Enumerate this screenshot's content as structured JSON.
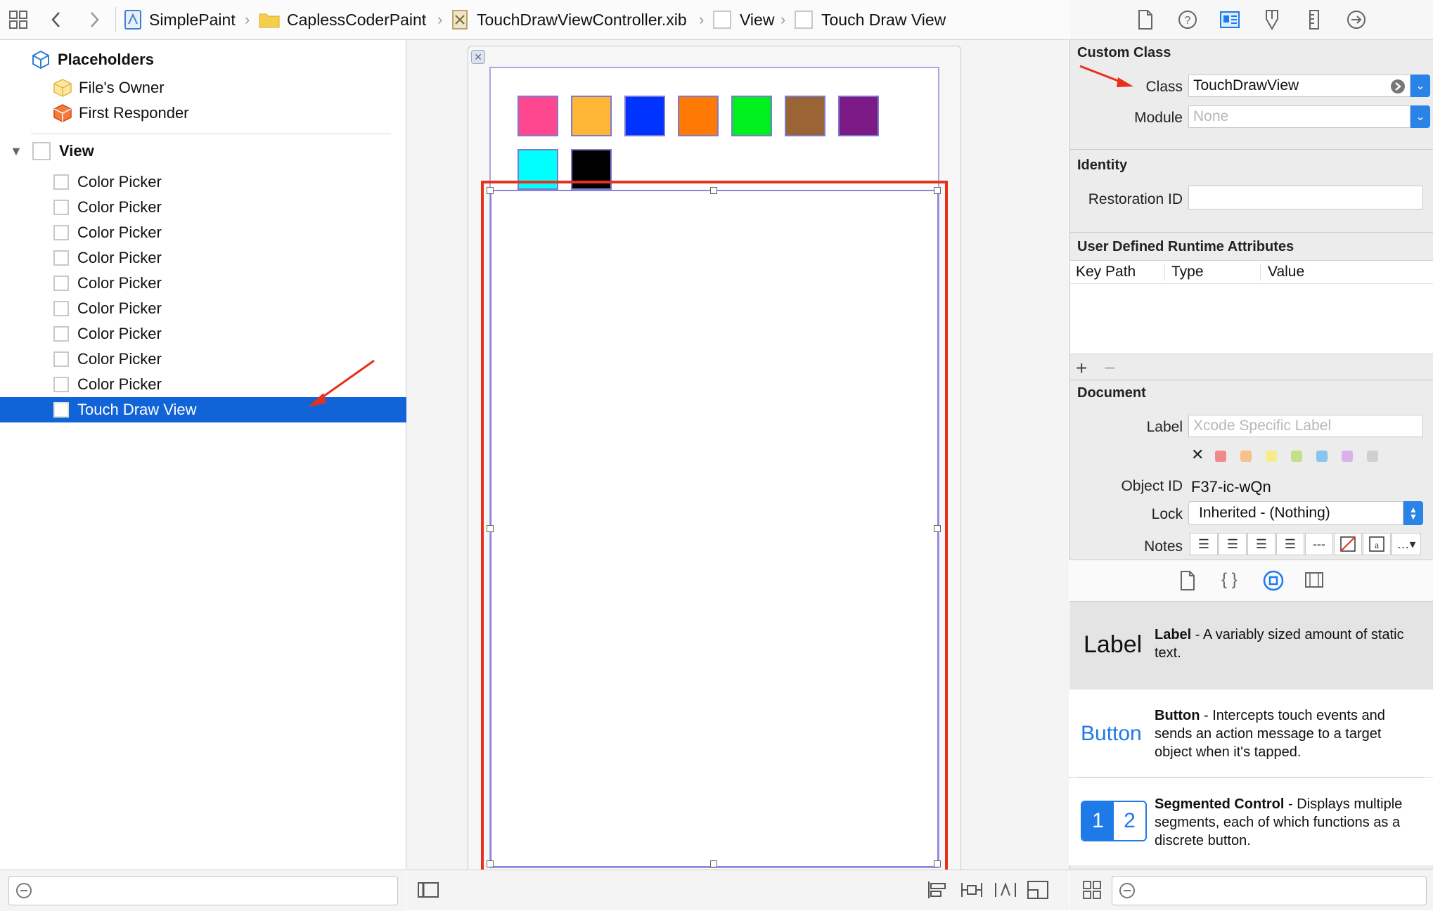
{
  "jumpbar": {
    "crumbs": [
      "SimplePaint",
      "CaplessCoderPaint",
      "TouchDrawViewController.xib",
      "View",
      "Touch Draw View"
    ]
  },
  "outline": {
    "placeholders_label": "Placeholders",
    "files_owner": "File's Owner",
    "first_responder": "First Responder",
    "view_label": "View",
    "color_pickers": [
      "Color Picker",
      "Color Picker",
      "Color Picker",
      "Color Picker",
      "Color Picker",
      "Color Picker",
      "Color Picker",
      "Color Picker",
      "Color Picker"
    ],
    "selected": "Touch Draw View"
  },
  "canvas": {
    "swatch_colors": [
      "#ff4790",
      "#ffb637",
      "#0033ff",
      "#ff7a05",
      "#00f01e",
      "#9a6434",
      "#7d1b86",
      "#00ffff",
      "#000000"
    ]
  },
  "inspector": {
    "custom_class": {
      "title": "Custom Class",
      "class_label": "Class",
      "class_value": "TouchDrawView",
      "module_label": "Module",
      "module_placeholder": "None"
    },
    "identity": {
      "title": "Identity",
      "restoration_label": "Restoration ID",
      "restoration_value": ""
    },
    "runtime_attrs": {
      "title": "User Defined Runtime Attributes",
      "columns": [
        "Key Path",
        "Type",
        "Value"
      ]
    },
    "document": {
      "title": "Document",
      "label_label": "Label",
      "label_placeholder": "Xcode Specific Label",
      "object_id_label": "Object ID",
      "object_id_value": "F37-ic-wQn",
      "lock_label": "Lock",
      "lock_value": "Inherited - (Nothing)",
      "notes_label": "Notes",
      "label_colors": [
        "#f08a8a",
        "#f6c18a",
        "#f6ec8a",
        "#c2e08a",
        "#8ac4f0",
        "#dcb0ec",
        "#cfcfcf"
      ]
    },
    "library": [
      {
        "icon_text": "Label",
        "name": "Label",
        "desc": " - A variably sized amount of static text."
      },
      {
        "icon_text": "Button",
        "name": "Button",
        "desc": " - Intercepts touch events and sends an action message to a target object when it's tapped."
      },
      {
        "icon_seg1": "1",
        "icon_seg2": "2",
        "name": "Segmented Control",
        "desc": " - Displays multiple segments, each of which functions as a discrete button."
      }
    ]
  }
}
